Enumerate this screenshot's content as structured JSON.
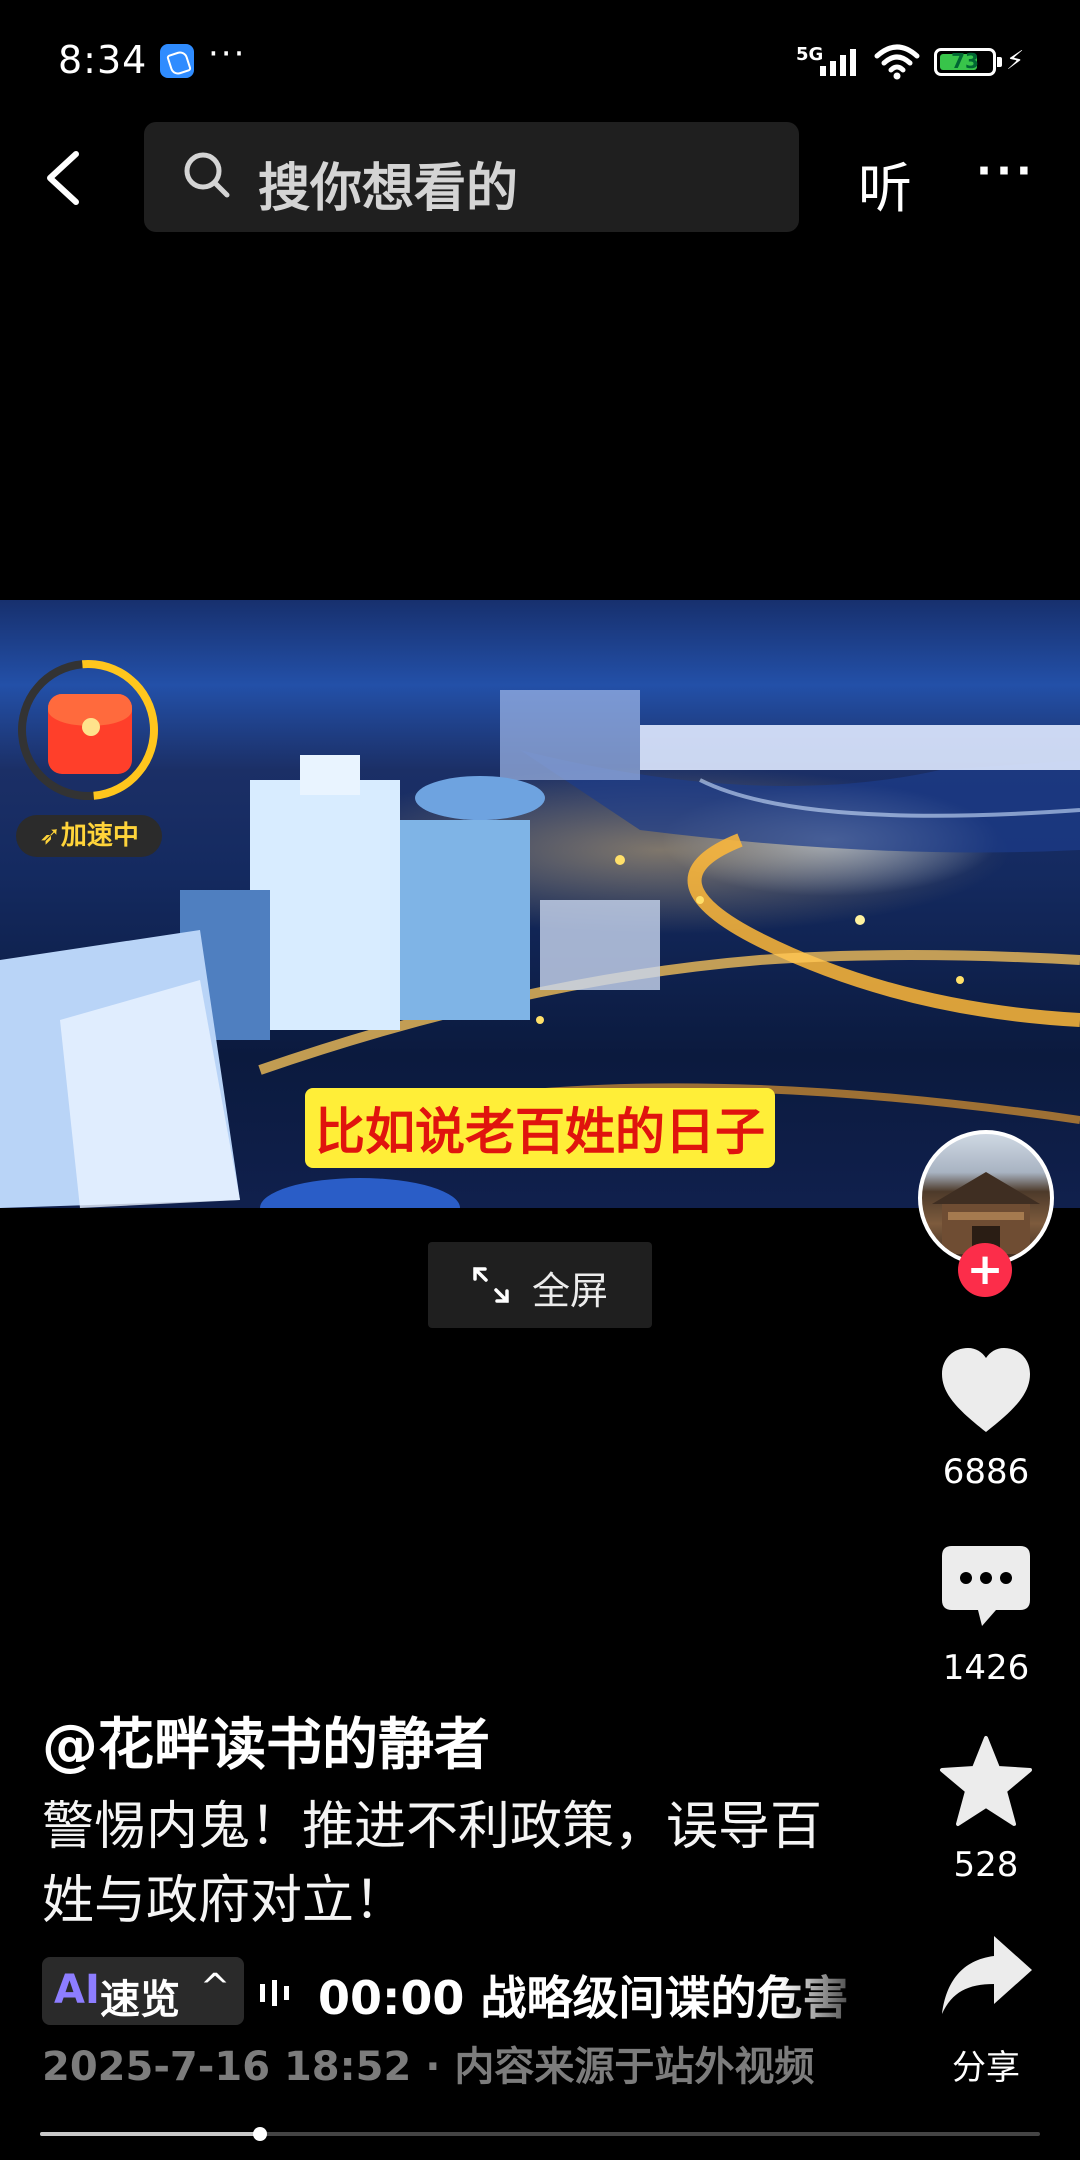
{
  "status_bar": {
    "time": "8:34",
    "more": "···",
    "network": "5G",
    "battery": "73",
    "battery_level": 0.73,
    "charging_icon": "bolt-icon"
  },
  "top_bar": {
    "search_placeholder": "搜你想看的",
    "listen_label": "听",
    "more_label": "···"
  },
  "video": {
    "subtitle": "比如说老百姓的日子",
    "speed_badge": "加速中",
    "fullscreen_label": "全屏"
  },
  "side": {
    "likes": "6886",
    "comments": "1426",
    "favorites": "528",
    "share_label": "分享",
    "follow_plus": "+"
  },
  "info": {
    "author": "@花畔读书的静者",
    "description": "警惕内鬼！推进不利政策，误导百姓与政府对立！",
    "ai_logo": "AI",
    "ai_label": "速览",
    "ai_chevron": "^",
    "ai_summary": "00:00 战略级间谍的危害",
    "meta": "2025-7-16 18:52 · 内容来源于站外视频"
  },
  "progress": {
    "played_fraction": 0.22
  },
  "colors": {
    "accent_red": "#fc2d4a",
    "subtitle_bg": "#ffee38",
    "subtitle_text": "#e0140e"
  }
}
